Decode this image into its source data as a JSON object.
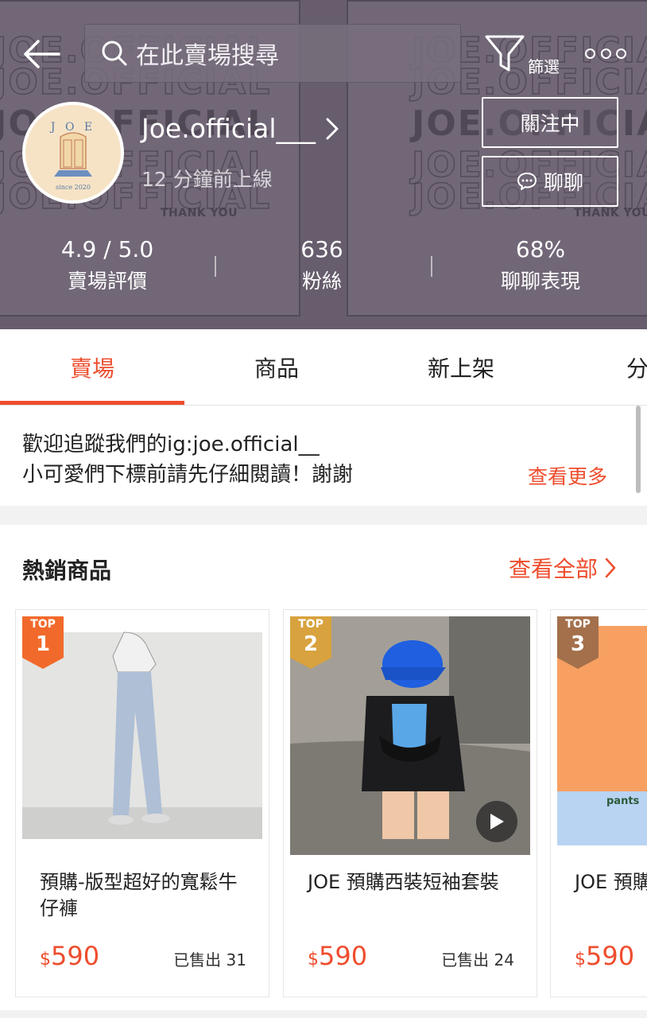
{
  "header": {
    "search_placeholder": "在此賣場搜尋",
    "filter_label": "篩選",
    "shop_name": "Joe.official___",
    "online_status": "12 分鐘前上線",
    "follow_label": "關注中",
    "chat_label": "聊聊",
    "background_word": "JOE.OFFICIAL",
    "background_thanks": "THANK YOU",
    "avatar_letters": "J O E",
    "avatar_since": "since 2020"
  },
  "stats": [
    {
      "value": "4.9 / 5.0",
      "label": "賣場評價"
    },
    {
      "value": "636",
      "label": "粉絲"
    },
    {
      "value": "68%",
      "label": "聊聊表現"
    }
  ],
  "tabs": [
    "賣場",
    "商品",
    "新上架",
    "分"
  ],
  "announcement": {
    "line1": "歡迎追蹤我們的ig:joe.official__",
    "line2": "小可愛們下標前請先仔細閱讀！謝謝",
    "see_more": "查看更多"
  },
  "hot_section": {
    "title": "熱銷商品",
    "view_all": "查看全部",
    "top_label": "TOP",
    "products": [
      {
        "rank": "1",
        "title": "預購-版型超好的寬鬆牛仔褲",
        "currency": "$",
        "price": "590",
        "sold": "已售出 31"
      },
      {
        "rank": "2",
        "title": "JOE 預購西裝短袖套裝",
        "currency": "$",
        "price": "590",
        "sold": "已售出 24"
      },
      {
        "rank": "3",
        "title": "JOE 預購",
        "currency": "$",
        "price": "590",
        "sold": "",
        "image_text": "pants"
      }
    ]
  },
  "colors": {
    "accent": "#ee4d2d",
    "header_bg": "#6b6270",
    "badge_1": "#f26a2b",
    "badge_2": "#d8a23e",
    "badge_3": "#a3704b"
  }
}
